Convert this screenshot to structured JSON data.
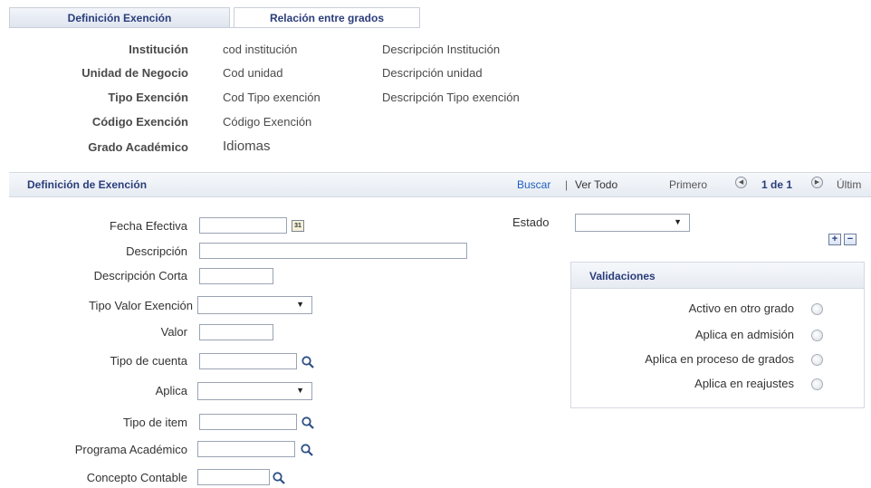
{
  "tabs": [
    {
      "label": "Definición Exención",
      "active": true
    },
    {
      "label": "Relación entre grados",
      "active": false
    }
  ],
  "header_fields": [
    {
      "label": "Institución",
      "code": "cod institución",
      "description": "Descripción Institución"
    },
    {
      "label": "Unidad de Negocio",
      "code": "Cod unidad",
      "description": "Descripción unidad"
    },
    {
      "label": "Tipo Exención",
      "code": "Cod Tipo exención",
      "description": "Descripción Tipo exención"
    },
    {
      "label": "Código Exención",
      "code": "Código Exención",
      "description": ""
    },
    {
      "label": "Grado Académico",
      "code": "Idiomas",
      "description": ""
    }
  ],
  "panel": {
    "title": "Definición de Exención",
    "find_link": "Buscar",
    "separator": "|",
    "view_all_link": "Ver Todo",
    "first_label": "Primero",
    "page_indicator": "1 de 1",
    "last_label": "Últim"
  },
  "form": {
    "fecha_efectiva": {
      "label": "Fecha Efectiva",
      "value": ""
    },
    "descripcion": {
      "label": "Descripción",
      "value": ""
    },
    "descripcion_corta": {
      "label": "Descripción Corta",
      "value": ""
    },
    "tipo_valor": {
      "label": "Tipo Valor Exención",
      "value": ""
    },
    "valor": {
      "label": "Valor",
      "value": ""
    },
    "tipo_cuenta": {
      "label": "Tipo de cuenta",
      "value": ""
    },
    "aplica": {
      "label": "Aplica",
      "value": ""
    },
    "tipo_item": {
      "label": "Tipo de item",
      "value": ""
    },
    "programa": {
      "label": "Programa Académico",
      "value": ""
    },
    "concepto": {
      "label": "Concepto Contable",
      "value": ""
    },
    "estado": {
      "label": "Estado",
      "value": ""
    }
  },
  "calendar_glyph": "31",
  "validaciones": {
    "title": "Validaciones",
    "items": [
      {
        "label": "Activo en otro grado",
        "checked": false
      },
      {
        "label": "Aplica en admisión",
        "checked": false
      },
      {
        "label": "Aplica en proceso de grados",
        "checked": false
      },
      {
        "label": "Aplica en reajustes",
        "checked": false
      }
    ]
  },
  "icons": {
    "calendar": "calendar-icon",
    "lookup": "search-icon",
    "add_row": "plus-icon",
    "delete_row": "minus-icon",
    "first": "previous-arrow-icon",
    "next": "next-arrow-icon",
    "dropdown": "chevron-down-icon"
  },
  "colors": {
    "accent_text": "#2a3d7a",
    "link": "#1f5fbf",
    "header_bg": "#e6ebf2"
  }
}
